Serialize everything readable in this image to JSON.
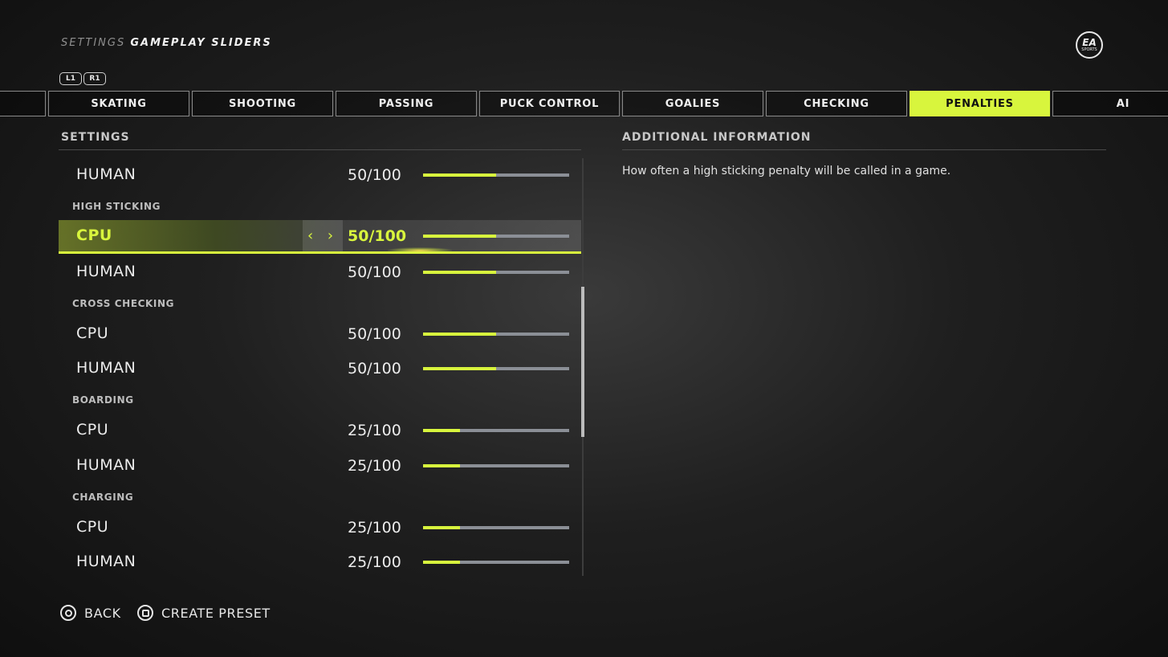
{
  "header": {
    "breadcrumb_section": "SETTINGS",
    "breadcrumb_page": "GAMEPLAY SLIDERS",
    "logo_text": "EA",
    "logo_subtext": "SPORTS",
    "bumper_left": "L1",
    "bumper_right": "R1"
  },
  "tabs": [
    {
      "label": ""
    },
    {
      "label": "SKATING"
    },
    {
      "label": "SHOOTING"
    },
    {
      "label": "PASSING"
    },
    {
      "label": "PUCK CONTROL"
    },
    {
      "label": "GOALIES"
    },
    {
      "label": "CHECKING"
    },
    {
      "label": "PENALTIES",
      "active": true
    },
    {
      "label": "AI"
    }
  ],
  "settings_header": "SETTINGS",
  "info_header": "ADDITIONAL INFORMATION",
  "info_text": "How often a high sticking penalty will be called in a game.",
  "categories": {
    "high_sticking": "HIGH STICKING",
    "cross_checking": "CROSS CHECKING",
    "boarding": "BOARDING",
    "charging": "CHARGING"
  },
  "rows": [
    {
      "label": "HUMAN",
      "value": "50/100",
      "fraction": 0.5
    },
    {
      "label": "CPU",
      "value": "50/100",
      "fraction": 0.5,
      "selected": true
    },
    {
      "label": "HUMAN",
      "value": "50/100",
      "fraction": 0.5
    },
    {
      "label": "CPU",
      "value": "50/100",
      "fraction": 0.5
    },
    {
      "label": "HUMAN",
      "value": "50/100",
      "fraction": 0.5
    },
    {
      "label": "CPU",
      "value": "25/100",
      "fraction": 0.25
    },
    {
      "label": "HUMAN",
      "value": "25/100",
      "fraction": 0.25
    },
    {
      "label": "CPU",
      "value": "25/100",
      "fraction": 0.25
    },
    {
      "label": "HUMAN",
      "value": "25/100",
      "fraction": 0.25
    }
  ],
  "selected_arrows": "‹ ›",
  "scroll_position": 0.31,
  "footer": {
    "back_label": "BACK",
    "preset_label": "CREATE PRESET"
  },
  "colors": {
    "accent": "#d8f53d",
    "track": "#8b8f96"
  }
}
